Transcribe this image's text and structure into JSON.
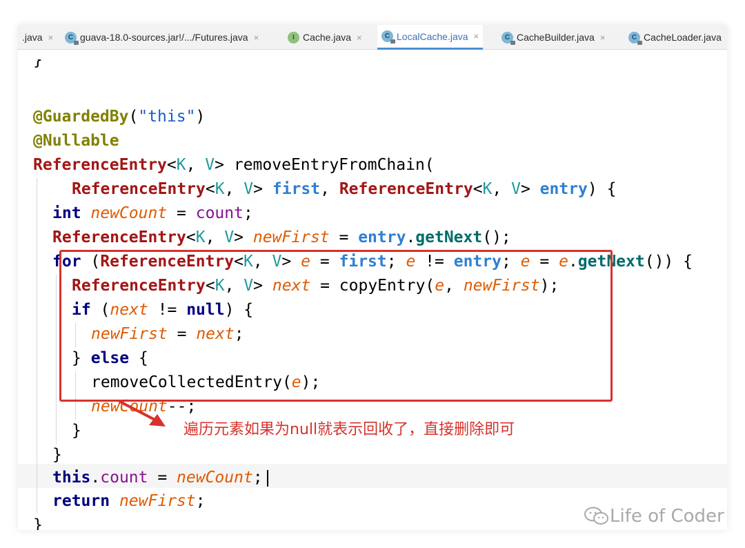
{
  "tabs": [
    {
      "label": ".java",
      "icon": "none",
      "active": false
    },
    {
      "label": "guava-18.0-sources.jar!/.../Futures.java",
      "icon": "class-locked-icon",
      "active": false
    },
    {
      "label": "Cache.java",
      "icon": "interface-icon",
      "active": false
    },
    {
      "label": "LocalCache.java",
      "icon": "class-locked-icon",
      "active": true
    },
    {
      "label": "CacheBuilder.java",
      "icon": "class-locked-icon",
      "active": false
    },
    {
      "label": "CacheLoader.java",
      "icon": "class-locked-icon",
      "active": false
    }
  ],
  "icon_letters": {
    "class": "C",
    "interface": "I"
  },
  "tab_close_glyph": "×",
  "code": {
    "l0": "}",
    "l1": {
      "a": "@GuardedBy",
      "b": "(",
      "c": "\"this\"",
      "d": ")"
    },
    "l2": "@Nullable",
    "l3": {
      "t": "ReferenceEntry",
      "g1": "<",
      "k": "K",
      "c": ", ",
      "v": "V",
      "g2": ">",
      "rest": " removeEntryFromChain("
    },
    "l4": {
      "t1": "ReferenceEntry",
      "g1": "<",
      "k1": "K",
      "c1": ", ",
      "v1": "V",
      "g2": "> ",
      "p1": "first",
      "sep": ", ",
      "t2": "ReferenceEntry",
      "g3": "<",
      "k2": "K",
      "c2": ", ",
      "v2": "V",
      "g4": "> ",
      "p2": "entry",
      "end": ") {"
    },
    "l5": {
      "kw": "int",
      "sp": " ",
      "loc": "newCount",
      "eq": " = ",
      "fld": "count",
      "semi": ";"
    },
    "l6": {
      "t": "ReferenceEntry",
      "g1": "<",
      "k": "K",
      "c": ", ",
      "v": "V",
      "g2": "> ",
      "loc": "newFirst",
      "eq": " = ",
      "p": "entry",
      "dot": ".",
      "m": "getNext",
      "end": "();"
    },
    "l7": {
      "kw": "for",
      "o": " (",
      "t": "ReferenceEntry",
      "g1": "<",
      "k": "K",
      "c": ", ",
      "v": "V",
      "g2": "> ",
      "e1": "e",
      "eq1": " = ",
      "p1": "first",
      "s1": "; ",
      "e2": "e",
      "ne": " != ",
      "p2": "entry",
      "s2": "; ",
      "e3": "e",
      "eq2": " = ",
      "e4": "e",
      "dot": ".",
      "m": "getNext",
      "end": "()) {"
    },
    "l8": {
      "t": "ReferenceEntry",
      "g1": "<",
      "k": "K",
      "c": ", ",
      "v": "V",
      "g2": "> ",
      "loc": "next",
      "eq": " = copyEntry(",
      "e": "e",
      "cm": ", ",
      "nf": "newFirst",
      "end": ");"
    },
    "l9": {
      "kw": "if",
      "o": " (",
      "loc": "next",
      "ne": " != ",
      "nul": "null",
      "end": ") {"
    },
    "l10": {
      "loc1": "newFirst",
      "eq": " = ",
      "loc2": "next",
      "semi": ";"
    },
    "l11": {
      "a": "} ",
      "kw": "else",
      "b": " {"
    },
    "l12": {
      "a": "removeCollectedEntry(",
      "e": "e",
      "b": ");"
    },
    "l13": {
      "loc": "newCount",
      "op": "--;"
    },
    "l14": "}",
    "l15": "}",
    "l16": {
      "kw": "this",
      "dot": ".",
      "fld": "count",
      "eq": " = ",
      "loc": "newCount",
      "semi": ";"
    },
    "l17": {
      "kw": "return",
      "sp": " ",
      "loc": "newFirst",
      "semi": ";"
    },
    "l18": "}"
  },
  "annotation": "遍历元素如果为null就表示回收了，直接删除即可",
  "watermark": "Life of Coder",
  "colors": {
    "highlight_box": "#d6322b",
    "active_tab_accent": "#4a8fd6",
    "current_line": "#f5f5f5"
  }
}
